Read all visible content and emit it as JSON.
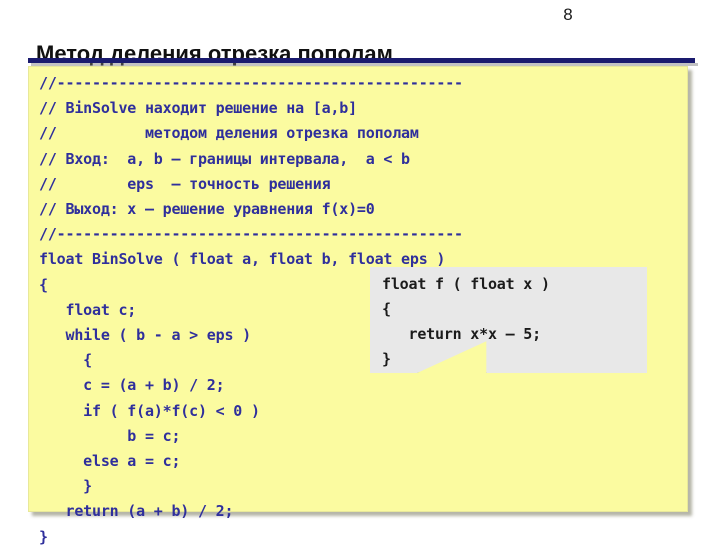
{
  "slide": {
    "number": "8",
    "title": "Метод деления отрезка пополам",
    "accent_color": "#1a1a6e",
    "panel_color": "#fbfba0",
    "code_color": "#2f2f9c",
    "callout_color": "#e8e8e8",
    "callout_text_color": "#1b1b1b"
  },
  "code_panel": {
    "lines": [
      "//----------------------------------------------",
      "// BinSolve находит решение на [a,b]",
      "//          методом деления отрезка пополам",
      "// Вход:  a, b – границы интервала,  a < b",
      "//        eps  – точность решения",
      "// Выход: x – решение уравнения f(x)=0",
      "//----------------------------------------------",
      "float BinSolve ( float a, float b, float eps )",
      "{",
      "   float c;",
      "   while ( b - a > eps )",
      "     {",
      "     c = (a + b) / 2;",
      "     if ( f(a)*f(c) < 0 )",
      "          b = c;",
      "     else a = c;",
      "     }",
      "   return (a + b) / 2;",
      "}"
    ]
  },
  "callout": {
    "lines": [
      "float f ( float x )",
      "{",
      "   return x*x – 5;",
      "}"
    ]
  }
}
